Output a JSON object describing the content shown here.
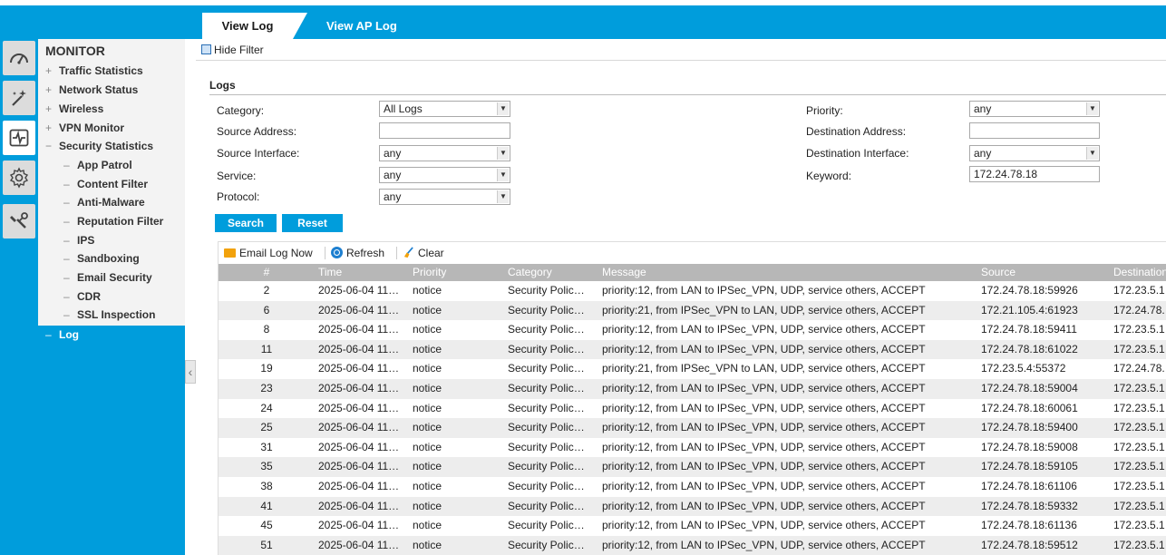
{
  "tabs": {
    "view_log": "View Log",
    "view_ap_log": "View AP Log"
  },
  "nav": {
    "title": "MONITOR",
    "items": [
      {
        "label": "Traffic Statistics",
        "marker": "+"
      },
      {
        "label": "Network Status",
        "marker": "+"
      },
      {
        "label": "Wireless",
        "marker": "+"
      },
      {
        "label": "VPN Monitor",
        "marker": "+"
      },
      {
        "label": "Security Statistics",
        "marker": "−"
      }
    ],
    "sub_items": [
      {
        "label": "App Patrol",
        "marker": "–"
      },
      {
        "label": "Content Filter",
        "marker": "–"
      },
      {
        "label": "Anti-Malware",
        "marker": "–"
      },
      {
        "label": "Reputation Filter",
        "marker": "–"
      },
      {
        "label": "IPS",
        "marker": "–"
      },
      {
        "label": "Sandboxing",
        "marker": "–"
      },
      {
        "label": "Email Security",
        "marker": "–"
      },
      {
        "label": "CDR",
        "marker": "–"
      },
      {
        "label": "SSL Inspection",
        "marker": "–"
      }
    ],
    "log": {
      "label": "Log",
      "marker": "–"
    }
  },
  "filter": {
    "hide_filter": "Hide Filter",
    "section_title": "Logs",
    "category_label": "Category:",
    "category_value": "All Logs",
    "source_address_label": "Source Address:",
    "source_address_value": "",
    "source_interface_label": "Source Interface:",
    "source_interface_value": "any",
    "service_label": "Service:",
    "service_value": "any",
    "protocol_label": "Protocol:",
    "protocol_value": "any",
    "priority_label": "Priority:",
    "priority_value": "any",
    "destination_address_label": "Destination Address:",
    "destination_address_value": "",
    "destination_interface_label": "Destination Interface:",
    "destination_interface_value": "any",
    "keyword_label": "Keyword:",
    "keyword_value": "172.24.78.18",
    "search_button": "Search",
    "reset_button": "Reset"
  },
  "toolbar": {
    "email_log_now": "Email Log Now",
    "refresh": "Refresh",
    "clear": "Clear"
  },
  "table": {
    "columns": [
      "#",
      "Time",
      "Priority",
      "Category",
      "Message",
      "Source",
      "Destination"
    ],
    "rows": [
      {
        "num": "2",
        "time": "2025-06-04 11…",
        "priority": "notice",
        "category": "Security Polic…",
        "message": "priority:12, from LAN to IPSec_VPN, UDP, service others, ACCEPT",
        "source": "172.24.78.18:59926",
        "destination": "172.23.5.1"
      },
      {
        "num": "6",
        "time": "2025-06-04 11…",
        "priority": "notice",
        "category": "Security Polic…",
        "message": "priority:21, from IPSec_VPN to LAN, UDP, service others, ACCEPT",
        "source": "172.21.105.4:61923",
        "destination": "172.24.78."
      },
      {
        "num": "8",
        "time": "2025-06-04 11…",
        "priority": "notice",
        "category": "Security Polic…",
        "message": "priority:12, from LAN to IPSec_VPN, UDP, service others, ACCEPT",
        "source": "172.24.78.18:59411",
        "destination": "172.23.5.1"
      },
      {
        "num": "11",
        "time": "2025-06-04 11…",
        "priority": "notice",
        "category": "Security Polic…",
        "message": "priority:12, from LAN to IPSec_VPN, UDP, service others, ACCEPT",
        "source": "172.24.78.18:61022",
        "destination": "172.23.5.1"
      },
      {
        "num": "19",
        "time": "2025-06-04 11…",
        "priority": "notice",
        "category": "Security Polic…",
        "message": "priority:21, from IPSec_VPN to LAN, UDP, service others, ACCEPT",
        "source": "172.23.5.4:55372",
        "destination": "172.24.78."
      },
      {
        "num": "23",
        "time": "2025-06-04 11…",
        "priority": "notice",
        "category": "Security Polic…",
        "message": "priority:12, from LAN to IPSec_VPN, UDP, service others, ACCEPT",
        "source": "172.24.78.18:59004",
        "destination": "172.23.5.1"
      },
      {
        "num": "24",
        "time": "2025-06-04 11…",
        "priority": "notice",
        "category": "Security Polic…",
        "message": "priority:12, from LAN to IPSec_VPN, UDP, service others, ACCEPT",
        "source": "172.24.78.18:60061",
        "destination": "172.23.5.1"
      },
      {
        "num": "25",
        "time": "2025-06-04 11…",
        "priority": "notice",
        "category": "Security Polic…",
        "message": "priority:12, from LAN to IPSec_VPN, UDP, service others, ACCEPT",
        "source": "172.24.78.18:59400",
        "destination": "172.23.5.1"
      },
      {
        "num": "31",
        "time": "2025-06-04 11…",
        "priority": "notice",
        "category": "Security Polic…",
        "message": "priority:12, from LAN to IPSec_VPN, UDP, service others, ACCEPT",
        "source": "172.24.78.18:59008",
        "destination": "172.23.5.1"
      },
      {
        "num": "35",
        "time": "2025-06-04 11…",
        "priority": "notice",
        "category": "Security Polic…",
        "message": "priority:12, from LAN to IPSec_VPN, UDP, service others, ACCEPT",
        "source": "172.24.78.18:59105",
        "destination": "172.23.5.1"
      },
      {
        "num": "38",
        "time": "2025-06-04 11…",
        "priority": "notice",
        "category": "Security Polic…",
        "message": "priority:12, from LAN to IPSec_VPN, UDP, service others, ACCEPT",
        "source": "172.24.78.18:61106",
        "destination": "172.23.5.1"
      },
      {
        "num": "41",
        "time": "2025-06-04 11…",
        "priority": "notice",
        "category": "Security Polic…",
        "message": "priority:12, from LAN to IPSec_VPN, UDP, service others, ACCEPT",
        "source": "172.24.78.18:59332",
        "destination": "172.23.5.1"
      },
      {
        "num": "45",
        "time": "2025-06-04 11…",
        "priority": "notice",
        "category": "Security Polic…",
        "message": "priority:12, from LAN to IPSec_VPN, UDP, service others, ACCEPT",
        "source": "172.24.78.18:61136",
        "destination": "172.23.5.1"
      },
      {
        "num": "51",
        "time": "2025-06-04 11…",
        "priority": "notice",
        "category": "Security Polic…",
        "message": "priority:12, from LAN to IPSec_VPN, UDP, service others, ACCEPT",
        "source": "172.24.78.18:59512",
        "destination": "172.23.5.1"
      }
    ]
  },
  "icons": {
    "rail": [
      "dashboard-gauge-icon",
      "wizard-wand-icon",
      "monitor-pulse-icon",
      "gear-icon",
      "tools-wrench-icon"
    ],
    "toolbar": [
      "email-icon",
      "refresh-icon",
      "broom-clear-icon"
    ]
  },
  "colors": {
    "brand": "#009ddc",
    "header_row": "#b7b7b7",
    "alt_row": "#ededed",
    "nav_bg": "#f3f3f3"
  }
}
